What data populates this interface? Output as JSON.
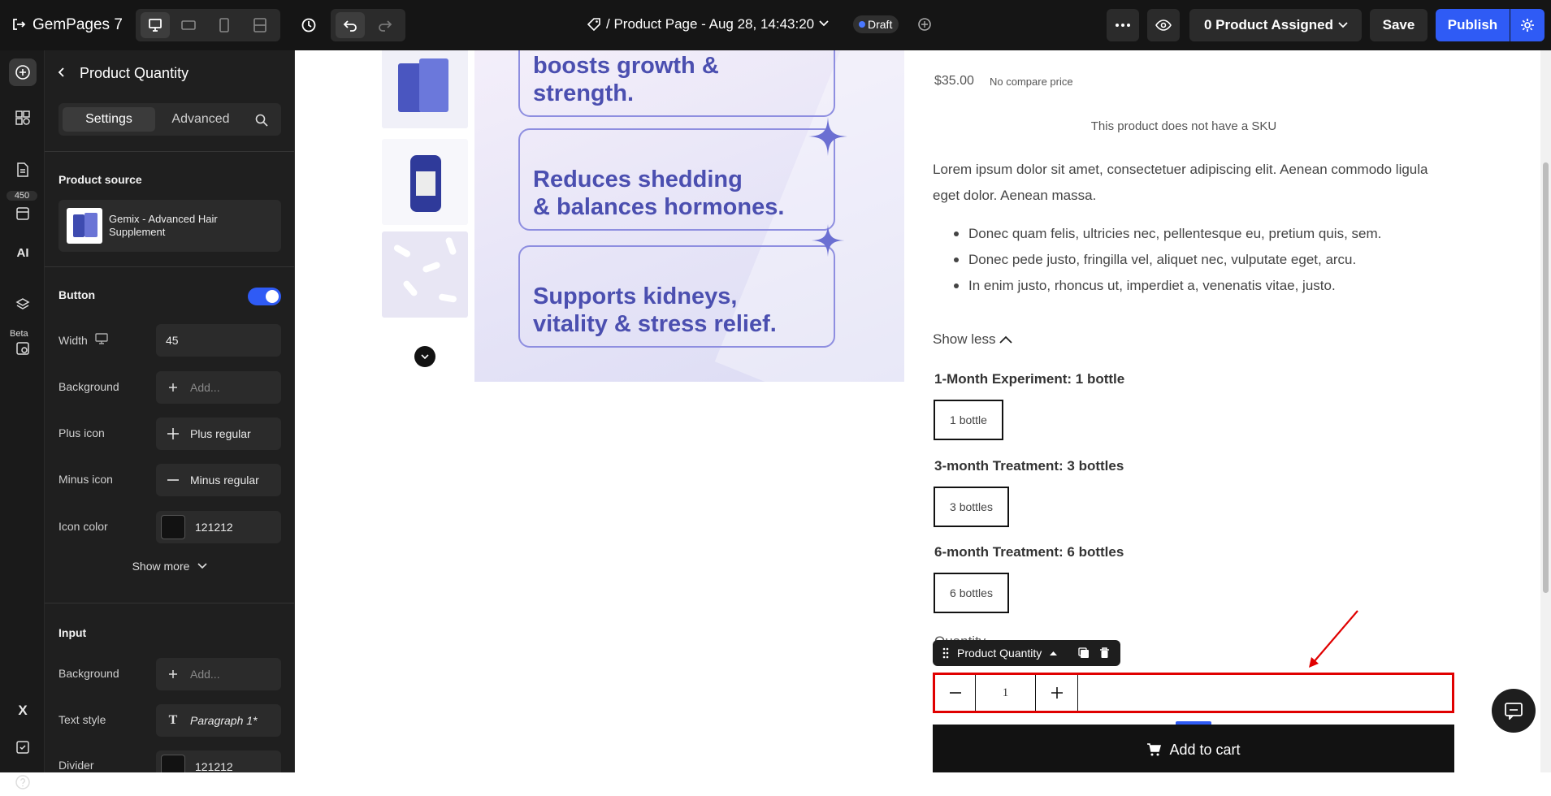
{
  "topbar": {
    "brand": "GemPages 7",
    "page_title": "/ Product Page - Aug 28, 14:43:20",
    "status_badge": "Draft",
    "product_assigned": "0 Product Assigned",
    "save_label": "Save",
    "publish_label": "Publish"
  },
  "rail": {
    "badge_count": "450",
    "beta_label": "Beta"
  },
  "panel": {
    "title": "Product Quantity",
    "tabs": [
      "Settings",
      "Advanced"
    ],
    "product_source_label": "Product source",
    "product_name": "Gemix - Advanced Hair Supplement",
    "button_section": "Button",
    "button_toggle": "on",
    "width_label": "Width",
    "width_value": "45",
    "background_label": "Background",
    "background_placeholder": "Add...",
    "plus_icon_label": "Plus icon",
    "plus_icon_value": "Plus regular",
    "minus_icon_label": "Minus icon",
    "minus_icon_value": "Minus regular",
    "icon_color_label": "Icon color",
    "icon_color_value": "121212",
    "icon_color_hex": "#121212",
    "show_more": "Show more",
    "input_section": "Input",
    "input_background_label": "Background",
    "input_background_placeholder": "Add...",
    "text_style_label": "Text style",
    "text_style_value": "Paragraph 1*",
    "divider_label": "Divider",
    "divider_value": "121212"
  },
  "canvas": {
    "banner_lines": [
      "boosts growth & strength.",
      "Reduces shedding\n& balances hormones.",
      "Supports kidneys,\nvitality & stress relief."
    ],
    "price": "$35.00",
    "compare_price": "No compare price",
    "sku_text": "This product does not have a SKU",
    "description": "Lorem ipsum dolor sit amet, consectetuer adipiscing elit. Aenean commodo ligula eget dolor. Aenean massa.",
    "bullets": [
      "Donec quam felis, ultricies nec, pellentesque eu, pretium quis, sem.",
      "Donec pede justo, fringilla vel, aliquet nec, vulputate eget, arcu.",
      "In enim justo, rhoncus ut, imperdiet a, venenatis vitae, justo."
    ],
    "show_less": "Show less",
    "variants": [
      {
        "label": "1-Month Experiment: 1 bottle",
        "option": "1 bottle"
      },
      {
        "label": "3-month Treatment: 3 bottles",
        "option": "3 bottles"
      },
      {
        "label": "6-month Treatment: 6 bottles",
        "option": "6 bottles"
      }
    ],
    "quantity_heading": "Quantity",
    "selection_tag": "Product Quantity",
    "quantity_value": "1",
    "add_to_cart": "Add to cart"
  },
  "colors": {
    "accent": "#2f5bf5",
    "selection_border": "#e00000",
    "banner_text": "#4b4fb0"
  }
}
